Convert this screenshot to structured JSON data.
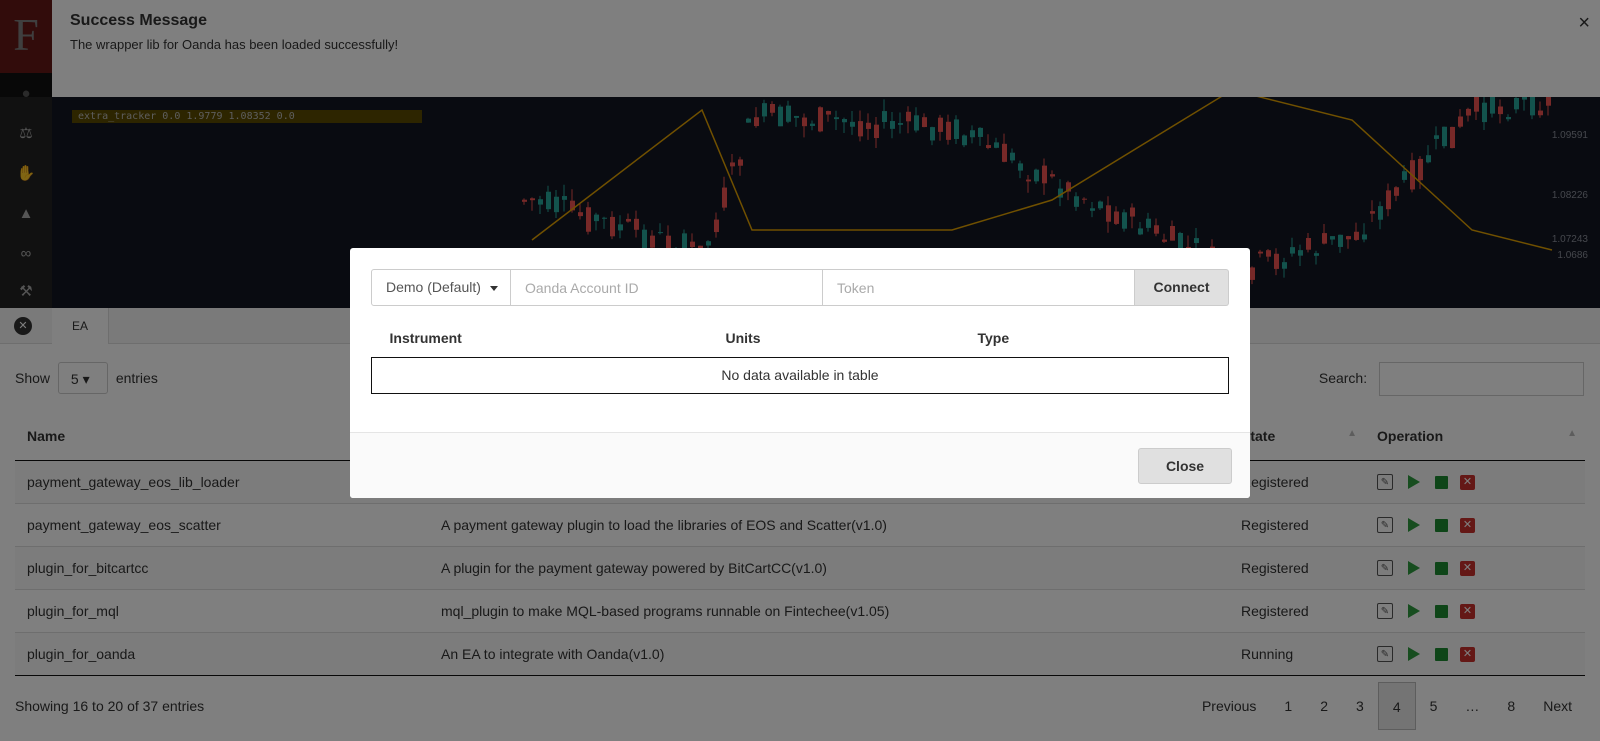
{
  "sidebar": {
    "logo_letter": "F",
    "icons": [
      "user-icon",
      "balance-scale-icon",
      "handshake-icon",
      "graduation-cap-icon",
      "eye-mask-icon",
      "wrench-icon"
    ]
  },
  "chart": {
    "price_labels": [
      "1.09591",
      "1.08226",
      "1.07243",
      "1.0686"
    ],
    "legend_line": "extra_tracker 0.0 1.9779 1.08352 0.0"
  },
  "tabs": {
    "ea_label": "EA"
  },
  "table_controls": {
    "show_label": "Show",
    "length_value": "5",
    "entries_label": "entries",
    "search_label": "Search:"
  },
  "ea_table": {
    "headers": {
      "name": "Name",
      "state": "State",
      "operation": "Operation"
    },
    "rows": [
      {
        "name": "payment_gateway_eos_lib_loader",
        "description": "",
        "state": "Registered"
      },
      {
        "name": "payment_gateway_eos_scatter",
        "description": "A payment gateway plugin to load the libraries of EOS and Scatter(v1.0)",
        "state": "Registered"
      },
      {
        "name": "plugin_for_bitcartcc",
        "description": "A plugin for the payment gateway powered by BitCartCC(v1.0)",
        "state": "Registered"
      },
      {
        "name": "plugin_for_mql",
        "description": "mql_plugin to make MQL-based programs runnable on Fintechee(v1.05)",
        "state": "Registered"
      },
      {
        "name": "plugin_for_oanda",
        "description": "An EA to integrate with Oanda(v1.0)",
        "state": "Running"
      }
    ],
    "info": "Showing 16 to 20 of 37 entries",
    "pagination": [
      "Previous",
      "1",
      "2",
      "3",
      "4",
      "5",
      "…",
      "8",
      "Next"
    ],
    "current_page": "4"
  },
  "notification": {
    "title": "Success Message",
    "text": "The wrapper lib for Oanda has been loaded successfully!",
    "close_glyph": "×"
  },
  "modal": {
    "env_select": "Demo (Default)",
    "account_placeholder": "Oanda Account ID",
    "token_placeholder": "Token",
    "connect_label": "Connect",
    "columns": {
      "instrument": "Instrument",
      "units": "Units",
      "type": "Type"
    },
    "empty_text": "No data available in table",
    "close_label": "Close"
  }
}
